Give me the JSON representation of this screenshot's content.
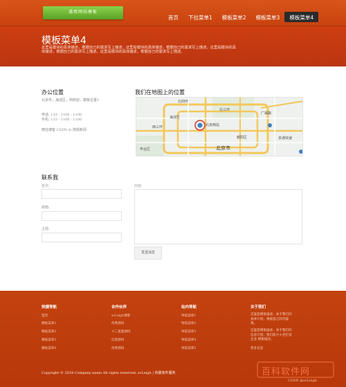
{
  "header": {
    "logo_text": "通用网站模板",
    "nav": [
      "首页",
      "下拉菜单1",
      "模板菜单2",
      "模板菜单3",
      "模板菜单4"
    ],
    "active_index": 4
  },
  "hero": {
    "title": "模板菜单4",
    "description": "这里是模块的具体描述，根据自己的需求写上描述。这里是模块的具体描述，根据自己的需求写上描述。这里是模块的具体描述，根据自己的需求写上描述。这里是模块的具体描述，根据自己的需求写上描述。"
  },
  "office": {
    "title": "办公位置",
    "address": "北京市，海淀区，阿莉亚，模板位置1",
    "phone": "电话: 133 - 1100 - 1100",
    "mobile": "手机: 133 - 1100 - 1100",
    "credit": "微信博客 CSDN & 搜狐新闻"
  },
  "map": {
    "title": "我们在地图上的位置",
    "labels": [
      "北四环",
      "北三环",
      "海淀区",
      "北京西站",
      "西三环",
      "北京市",
      "朝阳区",
      "丰台区",
      "广渠路",
      "京通快速"
    ]
  },
  "contact": {
    "title": "联系我",
    "name_label": "名字:",
    "email_label": "邮箱:",
    "subject_label": "主题:",
    "message_label": "内容:",
    "send_label": "发送消息"
  },
  "footer": {
    "columns": [
      {
        "title": "快捷导航",
        "links": [
          "首页",
          "模板菜单1",
          "模板菜单2",
          "模板菜单3",
          "模板菜单4"
        ]
      },
      {
        "title": "合作伙伴",
        "links": [
          "scLeigh博客",
          "优秀源码",
          "十二星座源码",
          "信管源码",
          "优秀源码"
        ]
      },
      {
        "title": "站内导航",
        "links": [
          "导航菜单1",
          "导航菜单2",
          "导航菜单3",
          "导航菜单4",
          "导航菜单5"
        ]
      },
      {
        "title": "关于我们",
        "about": [
          "这里是模板描述，关于我们的具体介绍，根据自己的内容来。",
          "这里是模板描述，关于我们的信息介绍，我们能力十佳打造企业 模板描述。",
          "更多信息"
        ]
      }
    ],
    "copyright": "Copyright © 2024 Company name All rights reserved. scLeigh | 欣晨软件服务",
    "watermark": "百科软件网",
    "watermark_small": "CSDN @scLeigh"
  },
  "colors": {
    "brand_orange": "#c9420f",
    "logo_green": "#6cb032",
    "active_nav": "#2a2a2a"
  }
}
